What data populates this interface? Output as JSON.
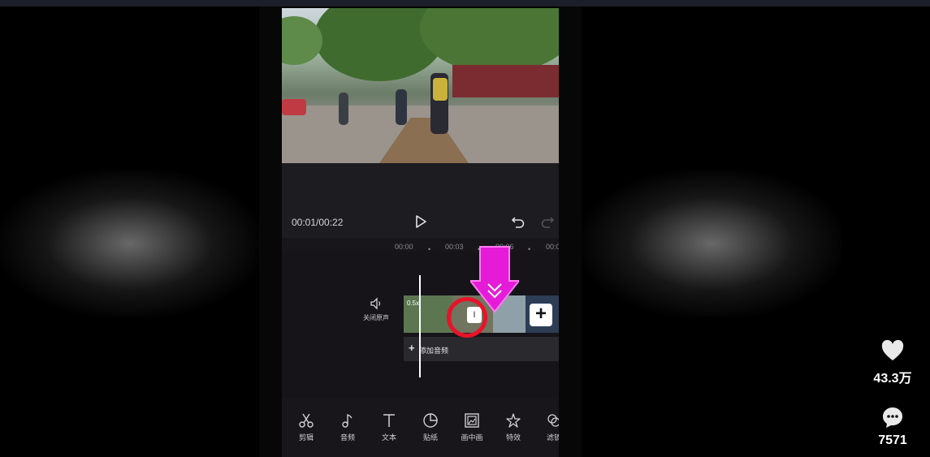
{
  "editor": {
    "timecode": "00:01/00:22",
    "ruler_ticks": [
      "00:00",
      "00:03",
      "00:06",
      "00:0"
    ],
    "mute_label": "关闭原声",
    "clip_speed": "0.5x",
    "add_clip_symbol": "+",
    "transition_symbol": "I",
    "add_audio": {
      "plus": "+",
      "label": "添加音频"
    }
  },
  "toolbar": [
    {
      "label": "剪辑",
      "icon": "scissors-icon"
    },
    {
      "label": "音频",
      "icon": "music-note-icon"
    },
    {
      "label": "文本",
      "icon": "text-icon"
    },
    {
      "label": "贴纸",
      "icon": "sticker-icon"
    },
    {
      "label": "画中画",
      "icon": "picture-in-picture-icon"
    },
    {
      "label": "特效",
      "icon": "effects-star-icon"
    },
    {
      "label": "滤镜",
      "icon": "filter-icon"
    }
  ],
  "side_actions": {
    "likes": "43.3万",
    "comments": "7571"
  },
  "colors": {
    "highlight_arrow": "#e61bd8",
    "highlight_ring": "#e8122a",
    "editor_bg": "#18161b"
  }
}
